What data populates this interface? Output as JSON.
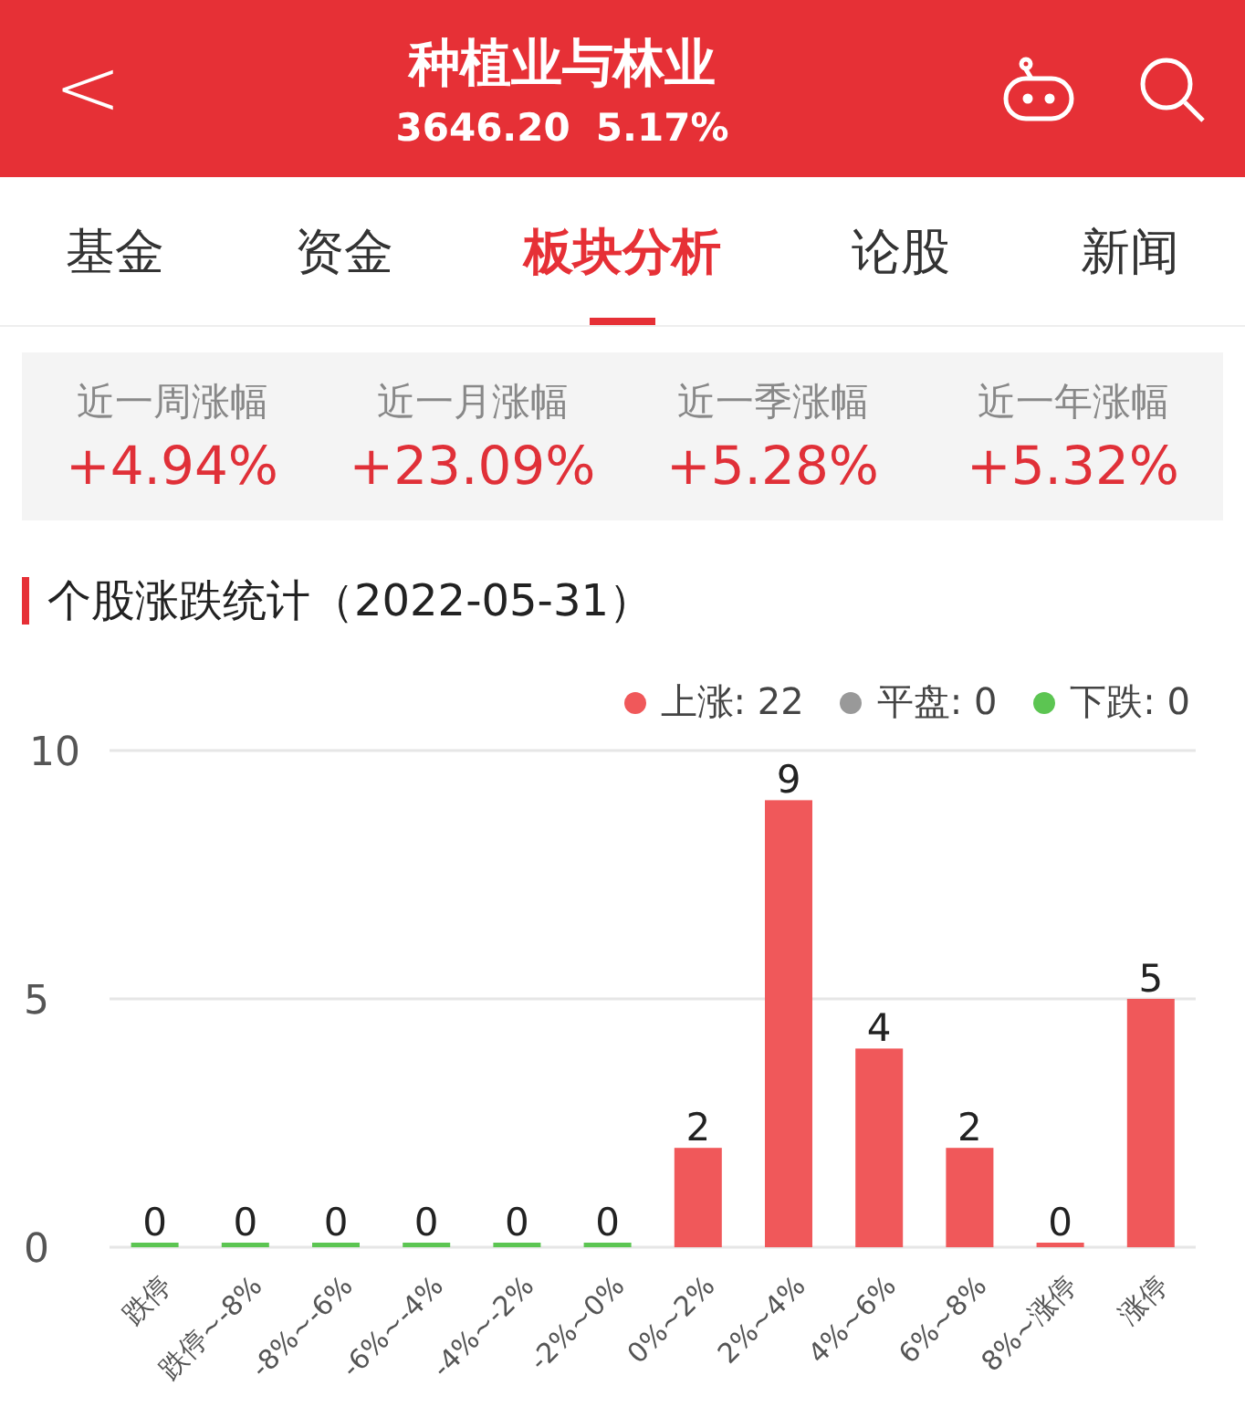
{
  "header": {
    "back": "<",
    "title": "种植业与林业",
    "price": "3646.20",
    "change": "5.17%"
  },
  "tabs": [
    {
      "label": "基金",
      "selected": false
    },
    {
      "label": "资金",
      "selected": false
    },
    {
      "label": "板块分析",
      "selected": true
    },
    {
      "label": "论股",
      "selected": false
    },
    {
      "label": "新闻",
      "selected": false
    }
  ],
  "stats": [
    {
      "label": "近一周涨幅",
      "value": "+4.94%"
    },
    {
      "label": "近一月涨幅",
      "value": "+23.09%"
    },
    {
      "label": "近一季涨幅",
      "value": "+5.28%"
    },
    {
      "label": "近一年涨幅",
      "value": "+5.32%"
    }
  ],
  "section": {
    "title": "个股涨跌统计（2022-05-31）"
  },
  "legend": [
    {
      "label": "上涨: 22",
      "color": "#f0585a"
    },
    {
      "label": "平盘: 0",
      "color": "#999999"
    },
    {
      "label": "下跌: 0",
      "color": "#5cc552"
    }
  ],
  "chart_data": {
    "type": "bar",
    "categories": [
      "跌停",
      "跌停~-8%",
      "-8%~-6%",
      "-6%~-4%",
      "-4%~-2%",
      "-2%~0%",
      "0%~2%",
      "2%~4%",
      "4%~6%",
      "6%~8%",
      "8%~涨停",
      "涨停"
    ],
    "series": [
      {
        "color": "#5cc552",
        "values": [
          0,
          0,
          0,
          0,
          0,
          0,
          null,
          null,
          null,
          null,
          null,
          null
        ]
      },
      {
        "color": "#f0585a",
        "values": [
          null,
          null,
          null,
          null,
          null,
          null,
          2,
          9,
          4,
          2,
          0,
          5
        ]
      }
    ],
    "ylim": [
      0,
      10
    ],
    "yticks": [
      0,
      5,
      10
    ],
    "data_labels": true
  }
}
